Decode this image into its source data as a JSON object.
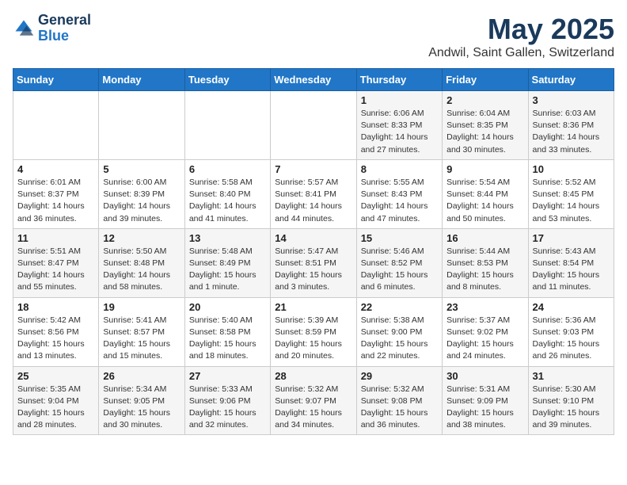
{
  "logo": {
    "line1": "General",
    "line2": "Blue"
  },
  "title": "May 2025",
  "subtitle": "Andwil, Saint Gallen, Switzerland",
  "days_header": [
    "Sunday",
    "Monday",
    "Tuesday",
    "Wednesday",
    "Thursday",
    "Friday",
    "Saturday"
  ],
  "weeks": [
    [
      {
        "day": "",
        "info": ""
      },
      {
        "day": "",
        "info": ""
      },
      {
        "day": "",
        "info": ""
      },
      {
        "day": "",
        "info": ""
      },
      {
        "day": "1",
        "info": "Sunrise: 6:06 AM\nSunset: 8:33 PM\nDaylight: 14 hours\nand 27 minutes."
      },
      {
        "day": "2",
        "info": "Sunrise: 6:04 AM\nSunset: 8:35 PM\nDaylight: 14 hours\nand 30 minutes."
      },
      {
        "day": "3",
        "info": "Sunrise: 6:03 AM\nSunset: 8:36 PM\nDaylight: 14 hours\nand 33 minutes."
      }
    ],
    [
      {
        "day": "4",
        "info": "Sunrise: 6:01 AM\nSunset: 8:37 PM\nDaylight: 14 hours\nand 36 minutes."
      },
      {
        "day": "5",
        "info": "Sunrise: 6:00 AM\nSunset: 8:39 PM\nDaylight: 14 hours\nand 39 minutes."
      },
      {
        "day": "6",
        "info": "Sunrise: 5:58 AM\nSunset: 8:40 PM\nDaylight: 14 hours\nand 41 minutes."
      },
      {
        "day": "7",
        "info": "Sunrise: 5:57 AM\nSunset: 8:41 PM\nDaylight: 14 hours\nand 44 minutes."
      },
      {
        "day": "8",
        "info": "Sunrise: 5:55 AM\nSunset: 8:43 PM\nDaylight: 14 hours\nand 47 minutes."
      },
      {
        "day": "9",
        "info": "Sunrise: 5:54 AM\nSunset: 8:44 PM\nDaylight: 14 hours\nand 50 minutes."
      },
      {
        "day": "10",
        "info": "Sunrise: 5:52 AM\nSunset: 8:45 PM\nDaylight: 14 hours\nand 53 minutes."
      }
    ],
    [
      {
        "day": "11",
        "info": "Sunrise: 5:51 AM\nSunset: 8:47 PM\nDaylight: 14 hours\nand 55 minutes."
      },
      {
        "day": "12",
        "info": "Sunrise: 5:50 AM\nSunset: 8:48 PM\nDaylight: 14 hours\nand 58 minutes."
      },
      {
        "day": "13",
        "info": "Sunrise: 5:48 AM\nSunset: 8:49 PM\nDaylight: 15 hours\nand 1 minute."
      },
      {
        "day": "14",
        "info": "Sunrise: 5:47 AM\nSunset: 8:51 PM\nDaylight: 15 hours\nand 3 minutes."
      },
      {
        "day": "15",
        "info": "Sunrise: 5:46 AM\nSunset: 8:52 PM\nDaylight: 15 hours\nand 6 minutes."
      },
      {
        "day": "16",
        "info": "Sunrise: 5:44 AM\nSunset: 8:53 PM\nDaylight: 15 hours\nand 8 minutes."
      },
      {
        "day": "17",
        "info": "Sunrise: 5:43 AM\nSunset: 8:54 PM\nDaylight: 15 hours\nand 11 minutes."
      }
    ],
    [
      {
        "day": "18",
        "info": "Sunrise: 5:42 AM\nSunset: 8:56 PM\nDaylight: 15 hours\nand 13 minutes."
      },
      {
        "day": "19",
        "info": "Sunrise: 5:41 AM\nSunset: 8:57 PM\nDaylight: 15 hours\nand 15 minutes."
      },
      {
        "day": "20",
        "info": "Sunrise: 5:40 AM\nSunset: 8:58 PM\nDaylight: 15 hours\nand 18 minutes."
      },
      {
        "day": "21",
        "info": "Sunrise: 5:39 AM\nSunset: 8:59 PM\nDaylight: 15 hours\nand 20 minutes."
      },
      {
        "day": "22",
        "info": "Sunrise: 5:38 AM\nSunset: 9:00 PM\nDaylight: 15 hours\nand 22 minutes."
      },
      {
        "day": "23",
        "info": "Sunrise: 5:37 AM\nSunset: 9:02 PM\nDaylight: 15 hours\nand 24 minutes."
      },
      {
        "day": "24",
        "info": "Sunrise: 5:36 AM\nSunset: 9:03 PM\nDaylight: 15 hours\nand 26 minutes."
      }
    ],
    [
      {
        "day": "25",
        "info": "Sunrise: 5:35 AM\nSunset: 9:04 PM\nDaylight: 15 hours\nand 28 minutes."
      },
      {
        "day": "26",
        "info": "Sunrise: 5:34 AM\nSunset: 9:05 PM\nDaylight: 15 hours\nand 30 minutes."
      },
      {
        "day": "27",
        "info": "Sunrise: 5:33 AM\nSunset: 9:06 PM\nDaylight: 15 hours\nand 32 minutes."
      },
      {
        "day": "28",
        "info": "Sunrise: 5:32 AM\nSunset: 9:07 PM\nDaylight: 15 hours\nand 34 minutes."
      },
      {
        "day": "29",
        "info": "Sunrise: 5:32 AM\nSunset: 9:08 PM\nDaylight: 15 hours\nand 36 minutes."
      },
      {
        "day": "30",
        "info": "Sunrise: 5:31 AM\nSunset: 9:09 PM\nDaylight: 15 hours\nand 38 minutes."
      },
      {
        "day": "31",
        "info": "Sunrise: 5:30 AM\nSunset: 9:10 PM\nDaylight: 15 hours\nand 39 minutes."
      }
    ]
  ]
}
